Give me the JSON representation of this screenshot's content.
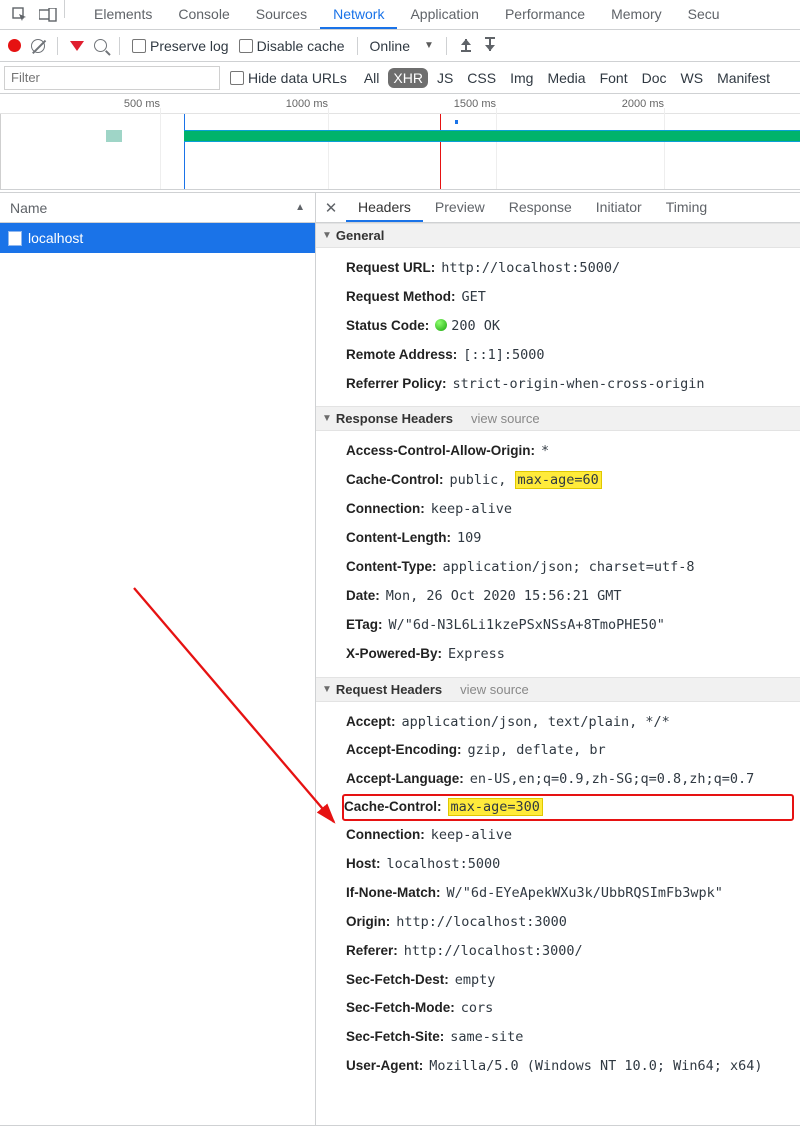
{
  "top_tabs": {
    "items": [
      "Elements",
      "Console",
      "Sources",
      "Network",
      "Application",
      "Performance",
      "Memory",
      "Secu"
    ],
    "active": "Network"
  },
  "toolbar": {
    "preserve_log": "Preserve log",
    "disable_cache": "Disable cache",
    "throttling": "Online"
  },
  "filterbar": {
    "placeholder": "Filter",
    "hide_data_urls": "Hide data URLs",
    "types": [
      "All",
      "XHR",
      "JS",
      "CSS",
      "Img",
      "Media",
      "Font",
      "Doc",
      "WS",
      "Manifest"
    ],
    "selected": "XHR"
  },
  "timeline": {
    "ticks": [
      "500 ms",
      "1000 ms",
      "1500 ms",
      "2000 ms"
    ]
  },
  "sidebar": {
    "column": "Name",
    "rows": [
      {
        "name": "localhost"
      }
    ]
  },
  "detail_tabs": {
    "items": [
      "Headers",
      "Preview",
      "Response",
      "Initiator",
      "Timing"
    ],
    "active": "Headers"
  },
  "sections": {
    "general": {
      "title": "General",
      "items": [
        {
          "k": "Request URL:",
          "v": "http://localhost:5000/",
          "mono": true
        },
        {
          "k": "Request Method:",
          "v": "GET",
          "mono": true
        },
        {
          "k": "Status Code:",
          "v": "200 OK",
          "mono": true,
          "status": true
        },
        {
          "k": "Remote Address:",
          "v": "[::1]:5000",
          "mono": true
        },
        {
          "k": "Referrer Policy:",
          "v": "strict-origin-when-cross-origin",
          "mono": true
        }
      ]
    },
    "response": {
      "title": "Response Headers",
      "view_source": "view source",
      "items": [
        {
          "k": "Access-Control-Allow-Origin:",
          "v": "*",
          "mono": true
        },
        {
          "k": "Cache-Control:",
          "v_pre": "public, ",
          "v_hl": "max-age=60",
          "mono": true
        },
        {
          "k": "Connection:",
          "v": "keep-alive",
          "mono": true
        },
        {
          "k": "Content-Length:",
          "v": "109",
          "mono": true
        },
        {
          "k": "Content-Type:",
          "v": "application/json; charset=utf-8",
          "mono": true
        },
        {
          "k": "Date:",
          "v": "Mon, 26 Oct 2020 15:56:21 GMT",
          "mono": true
        },
        {
          "k": "ETag:",
          "v": "W/\"6d-N3L6Li1kzePSxNSsA+8TmoPHE50\"",
          "mono": true
        },
        {
          "k": "X-Powered-By:",
          "v": "Express",
          "mono": true
        }
      ]
    },
    "request": {
      "title": "Request Headers",
      "view_source": "view source",
      "items": [
        {
          "k": "Accept:",
          "v": "application/json, text/plain, */*",
          "mono": true
        },
        {
          "k": "Accept-Encoding:",
          "v": "gzip, deflate, br",
          "mono": true
        },
        {
          "k": "Accept-Language:",
          "v": "en-US,en;q=0.9,zh-SG;q=0.8,zh;q=0.7",
          "mono": true
        },
        {
          "k": "Cache-Control:",
          "v_hl": "max-age=300",
          "mono": true,
          "redbox": true
        },
        {
          "k": "Connection:",
          "v": "keep-alive",
          "mono": true
        },
        {
          "k": "Host:",
          "v": "localhost:5000",
          "mono": true
        },
        {
          "k": "If-None-Match:",
          "v": "W/\"6d-EYeApekWXu3k/UbbRQSImFb3wpk\"",
          "mono": true
        },
        {
          "k": "Origin:",
          "v": "http://localhost:3000",
          "mono": true
        },
        {
          "k": "Referer:",
          "v": "http://localhost:3000/",
          "mono": true
        },
        {
          "k": "Sec-Fetch-Dest:",
          "v": "empty",
          "mono": true
        },
        {
          "k": "Sec-Fetch-Mode:",
          "v": "cors",
          "mono": true
        },
        {
          "k": "Sec-Fetch-Site:",
          "v": "same-site",
          "mono": true
        },
        {
          "k": "User-Agent:",
          "v": "Mozilla/5.0 (Windows NT 10.0; Win64; x64) ",
          "mono": true
        }
      ]
    }
  }
}
